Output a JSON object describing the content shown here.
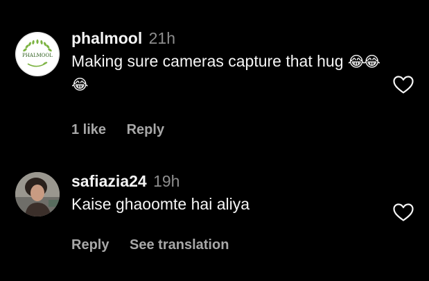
{
  "comments": [
    {
      "username": "phalmool",
      "time": "21h",
      "text": "Making sure cameras capture that hug",
      "emoji": "😂😂😂",
      "avatar_label": "PHALMOOL",
      "likes_label": "1 like",
      "reply_label": "Reply",
      "like_icon": "heart-outline-icon"
    },
    {
      "username": "safiazia24",
      "time": "19h",
      "text": "Kaise ghaoomte hai aliya",
      "reply_label": "Reply",
      "translate_label": "See translation",
      "like_icon": "heart-outline-icon"
    }
  ],
  "colors": {
    "background": "#000000",
    "primary_text": "#f5f5f5",
    "secondary_text": "#a8a8a8",
    "timestamp": "#8e8e8e"
  }
}
